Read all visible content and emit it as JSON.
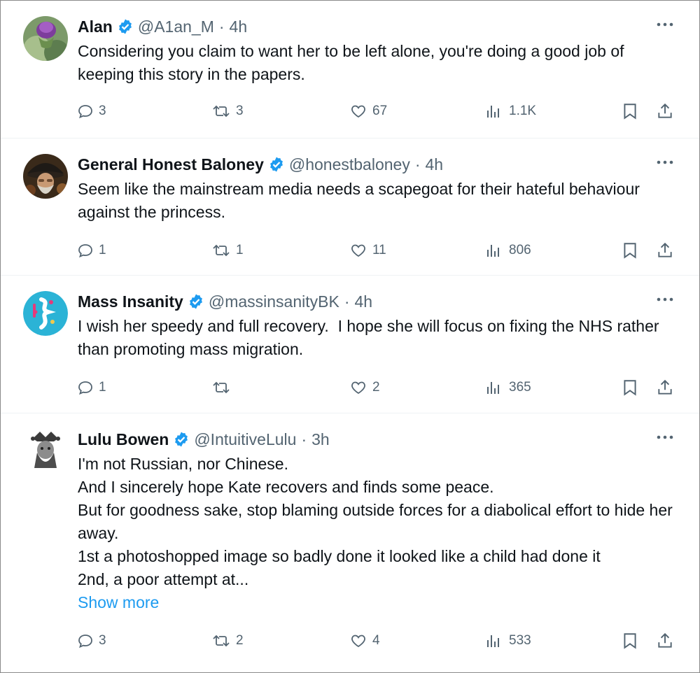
{
  "tweets": [
    {
      "name": "Alan",
      "handle": "@A1an_M",
      "time": "4h",
      "text": [
        "Considering you claim to want her to be left alone, you're doing a good job of keeping this story in the papers."
      ],
      "replies": "3",
      "reposts": "3",
      "likes": "67",
      "views": "1.1K"
    },
    {
      "name": "General Honest Baloney",
      "handle": "@honestbaloney",
      "time": "4h",
      "text": [
        "Seem like the mainstream media needs a scapegoat for their hateful behaviour against the princess."
      ],
      "replies": "1",
      "reposts": "1",
      "likes": "11",
      "views": "806"
    },
    {
      "name": "Mass Insanity",
      "handle": "@massinsanityBK",
      "time": "4h",
      "text": [
        "I wish her speedy and full recovery.  I hope she will focus on fixing the NHS rather than promoting mass migration."
      ],
      "replies": "1",
      "reposts": "",
      "likes": "2",
      "views": "365"
    },
    {
      "name": "Lulu Bowen",
      "handle": "@IntuitiveLulu",
      "time": "3h",
      "text": [
        "I'm not Russian, nor Chinese.",
        "And I sincerely hope Kate recovers and finds some peace.",
        "But for goodness sake, stop blaming outside forces for a diabolical effort to hide her away.",
        "1st a photoshopped image so badly done it looked like a child had done it",
        "2nd, a poor attempt at..."
      ],
      "show_more": "Show more",
      "replies": "3",
      "reposts": "2",
      "likes": "4",
      "views": "533"
    }
  ],
  "separator": "·",
  "colors": {
    "name": "#0f1419",
    "secondary": "#536471",
    "verified": "#1d9bf0",
    "link": "#1d9bf0"
  },
  "icons": [
    "verified-badge-icon",
    "more-icon",
    "reply-icon",
    "repost-icon",
    "like-icon",
    "views-icon",
    "bookmark-icon",
    "share-icon"
  ]
}
